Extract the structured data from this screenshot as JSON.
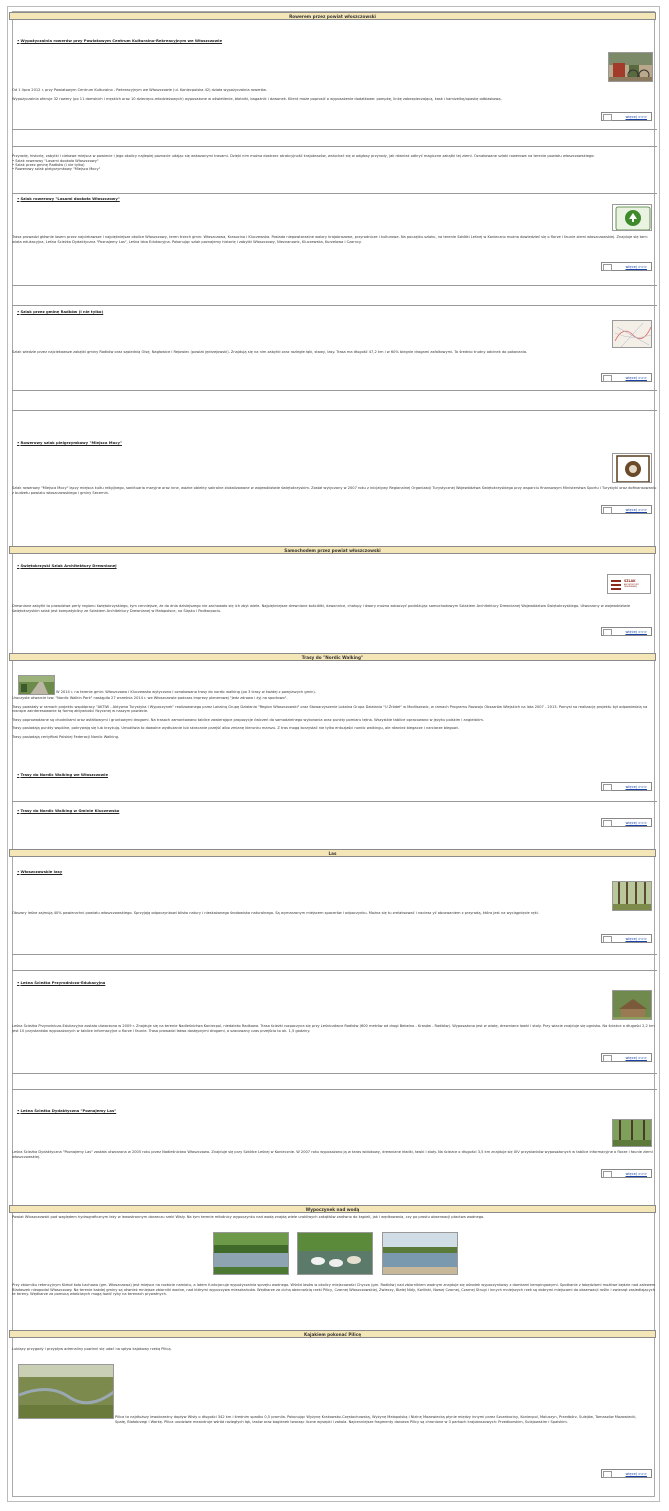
{
  "more_label": "więcej >>>",
  "sections": {
    "rowerem": "Rowerem przez powiat włoszczowski",
    "samochodem": "Samochodem przez powiat włoszczowski",
    "nordic": "Trasy do \"Nordic Walking\"",
    "las": "Las",
    "woda": "Wypoczynek nad wodą",
    "kajak": "Kajakiem pokonać Pilicę"
  },
  "wypozyczalnia": {
    "title": "Wypożyczalnia rowerów przy Powiatowym Centrum Kulturalno-Rekreacyjnym we Włoszczowie",
    "p1": "Od 1 lipca 2012 r. przy Powiatowym Centrum Kulturalno - Rekreacyjnym we Włoszczowie (ul. Koniecpolska 42) działa wypożyczalnia rowerów.",
    "p2": "Wypożyczalnia oferuje 32 rowery (po 11 damskich i męskich oraz 10 dziecięco-młodzieżowych) wyposażone w oświetlenie, błotniki, bagażnik i dzwonek. Klient może poprosić o wyposażenie dodatkowe: pompkę, linkę zabezpieczającą, kask i kamizelkę/opaskę odblaskową."
  },
  "intro": {
    "p": "Przyrodę, historię, zabytki i ciekawe miejsca w powiecie i jego okolicy najlepiej poznacie udając się wskazanymi trasami. Dzięki nim można dostrzec atrakcyjność krajobrazów, wsłuchać się w odgłosy przyrody, jak również odkryć magiczne zakątki tej ziemi. Oznakowane szlaki rowerowe na terenie powiatu włoszczowskiego:",
    "items": [
      "• Szlak rowerowy \"Lasami dookoła Włoszczowy\"",
      "• Szlak przez gminę Radków (i nie tylko)",
      "• Rowerowy szlak pielgrzymkowy \"Miejsca Mocy\""
    ]
  },
  "lasami": {
    "title": "Szlak rowerowy \"Lasami dookoła Włoszczowy\"",
    "p": "Trasa prowadzi głównie lasem przez najciekawsze i najpiękniejsze okolice Włoszczowy, teren trzech gmin: Włoszczowa, Krasocina i Kluczewska. Posiada niepowtarzalne walory krajobrazowe, przyrodnicze i kulturowe. Na początku szlaku, na terenie Szkółki Leśnej w Konieczno można dowiedzieć się o florze i faunie ziemi włoszczowskiej. Znajduje się tam: wiata edukacyjna, Leśna Ścieżka Dydaktyczna \"Poznajemy Las\", Leśna Izba Edukacyjna. Pokonując szlak poznajemy historię i zabytki Włoszczowy, Nieznanowic, Kluczewska, Kurzelowa i Czarncy.",
    "logo": "LASAMI DOOKOŁA WŁOSZCZOWY"
  },
  "radkow": {
    "title": "Szlak przez gminę Radków (i nie tylko)",
    "p": "Szlak wiedzie przez najciekawsze zakątki gminy Radków oraz sąsiednią Olsę, Nagłowice i Rejowiec (powiat jędrzejowski). Znajdują się na nim zabytki oraz rozległe łąki, stawy, lasy. Trasa ma długość 47,2 km i w 60% biegnie drogami asfaltowymi. To średnio trudny odcinek do pokonania."
  },
  "mocy": {
    "title": "Rowerowy szlak pielgrzymkowy \"Miejsca Mocy\"",
    "p": "Szlak rowerowy \"Miejsca Mocy\" łączy miejsca kultu religijnego, sanktuaria maryjne oraz inne, ważne obiekty sakralne zlokalizowane w województwie świętokrzyskim. Został wytyczony w 2007 roku z inicjatywy Regionalnej Organizacji Turystycznej Województwa Świętokrzyskiego przy wsparciu finansowym Ministerstwa Sportu i Turystyki oraz dofinansowaniu z budżetu powiatu włoszczowskiego i gminy Secemin."
  },
  "drewniana": {
    "title": "Świętokrzyski Szlak Architektury Drewnianej",
    "p": "Drewniane zabytki to prawdziwe perły regionu świętokrzyskiego, tym cenniejsze, że do dnia dzisiejszego nie zachowało się ich zbyt wiele. Najpiękniejsze drewniane kościółki, dzwonnice, chałupy i dwory można zobaczyć podróżując samochodowym Szlakiem Architektury Drewnianej Województwa Świętokrzyskiego. Utworzony w województwie świętokrzyskim szlak jest kompatybilny ze Szlakiem Architektury Drewnianej w Małopolsce, na Śląsku i Podkarpaciu.",
    "logo_line1": "SZLAK",
    "logo_line2": "ARCHITEKTURY DREWNIANEJ"
  },
  "nordic": {
    "p1": "W 2014 r. na terenie gmin: Włoszczowa i Kluczewsko wytyczono i oznakowano trasy do nordic walking (po 3 trasy w każdej z powyższych gmin).",
    "p1b": "Uroczyste otwarcie tzw. \"Nordic Walkin Park\" nastąpiło 27 września 2014 r. we Włoszczowie podczas imprezy plenerowej \"Jedz zdrowo i żyj na sportowo\".",
    "p2": "Trasy powstały w ramach projektu współpracy \"AKTIW - Aktywna Turystyka i Wypoczynek\" realizowanego przez Lokalną Grupę Działania \"Region Włoszczowski\" oraz Stowarzyszenie Lokalna Grupa Działania \"U Źródeł\" w Modliszewic, w ramach Programu Rozwoju Obszarów Wiejskich na lata 2007 - 2013. Pomysł na realizację projektu był odpowiedzią na rosnące zainteresowanie tą formą aktywności fizycznej w naszym powiecie.",
    "p3": "Trasy poprowadzone są chodnikami oraz asfaltowymi i gruntowymi drogami. Na trasach zamontowano tablice zawierające propozycje ćwiczeń do samodzielnego wykonania oraz punkty pomiaru tętna. Wszystkie tablice opracowano w języku polskim i angielskim.",
    "p4": "Trasy posiadają punkty wspólne, pokrywają się lub krzyżują. Umożliwia to dowolne wydłużanie lub skracanie przejść albo zmianę kierunku marszu. Z tras mogą korzystać nie tylko entuzjaści nordic walkingu, ale również biegacze i narciarze biegowi.",
    "p5": "Trasy posiadają certyfikat Polskiej Federacji Nordic Walking.",
    "link1": "Trasy do Nordic Walking we Włoszczowie",
    "link2": "Trasy do Nordic Walking w Gminie Kluczewsko"
  },
  "lasy": {
    "title": "Włoszczowskie lasy",
    "p": "Obszary leśne zajmują 40% powierzchni powiatu włoszczowskiego. Sprzyjają odpoczynkowi blisko natury i nieskażonego środowiska naturalnego. Są wymarzonym miejscem spacerów i odpoczynku. Można się tu zrelaksować i naciesz yć obcowaniem z przyrodą, która jest na wyciągnięcie ręki."
  },
  "sciezka": {
    "title": "Leśna Ścieżka Przyrodniczo-Edukacyjna",
    "p": "Leśna Ścieżka Przyrodniczo-Edukacyjna została utworzona w 2009 r. Znajduje się na terenie Nadleśnictwa Koniecpol, niedaleko Radkowa. Trasa ścieżki rozpoczyna się przy Leśniczówce Radków (600 metrów od drogi Bebelno - Krasów - Radków). Wyposażona jest w wiatę, drewniane ławki i stoły. Przy wiacie znajduje się ognisko. Na ścieżce o długości 2,2 km jest 10 przystanków wyposażonych w tablice informacyjne o florze i faunie. Trasa prowadzi łatwo dostępnymi drogami, a szacowany czas przejścia to ok. 1,5 godziny."
  },
  "dydaktyczna": {
    "title": "Leśna Ścieżka Dydaktyczna \"Poznajemy Las\"",
    "p": "Leśna Ścieżka Dydaktyczna \"Poznajemy Las\" została utworzona w 2005 roku przez Nadleśnictwo Włoszczowa. Znajduje się przy Szkółce Leśnej w Koniecznie. W 2007 roku wyposażono ją w taras widokowy, drewniane kładki, ławki i stoły. Na ścieżce o długości 3,5 km znajduje się XIV przystanków wyposażonych w tablice informacyjne o florze i faunie ziemi włoszczowskiej."
  },
  "woda": {
    "p1": "Powiat Włoszczowski pod względem hydrograficznym leży w lewostronnym dorzeczu rzeki Wisły. Na tym terenie miłośnicy wypoczynku nad wodą znajdą wiele urokliwych zakątków zarówno do kąpieli, jak i wędkowania, czy po prostu obserwacji ptactwa wodnego.",
    "p2": "Przy zbiorniku retencyjnym Klekoł koło Łachowa (gm. Włoszczowa) jest miejsce na rozbicie namiotu, a latem funkcjonuje wypożyczalnia sprzętu wodnego. Wśród lasów w okolicy miejscowości Chycza (gm. Radków) nad zbiornikiem wodnym znajduje się ośrodek wypoczynkowy z domkami kempingowymi. Spotkanie z łabędziami możliwe będzie nad zalewem Bladaszek nieopodal Włoszczowy. Na terenie każdej gminy są również mniejsze zbiorniki wodne, nad którymi wypoczywa mieszkańców. Wędkarze za cichą obecnością rzeki Pilicy, Czarnej Włoszczowskiej, Zwleczy, Białej Nidy, Kwilinki, Nowej Czarnej, Czarnej Strugi i innych mniejszych rzek są dobrymi miejscami do obserwacji roślin i zwierząt zasiedlających te tereny. Wędkarze za pomocą właściwych mogą łowić ryby na terenach prywatnych."
  },
  "kajak": {
    "p1": "Lubiący przygody i przypływ adrenaliny powinni się udać na spływ kajakowy rzeką Pilicą.",
    "p2": "Pilica to najdłuższy lewobrzeżny dopływ Wisły o długości 342 km i średnim spadku 0,5 promila. Pokonując Wyżynę Krakowsko-Częstochowską, Wyżynę Małopolską i Nizinę Mazowiecką płynie między innymi przez Szczekociny, Koniecpol, Maluszyn, Przedbórz, Sulejów, Tomaszów Mazowiecki, Spałę, Białobrzegi i Warkę. Pilica urodziwie meandruje wśród rozległych łąk, lasów oraz bagienek tworząc liczne wysepki i zakola. Najcenniejsze fragmenty doroeza Pilicy są chronione w 3 parkach krajobrazowych: Przedborskim, Sulejowskim i Spalskim."
  }
}
